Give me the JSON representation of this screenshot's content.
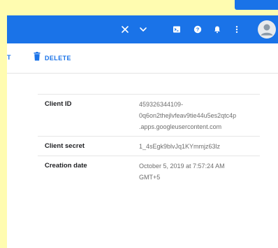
{
  "header": {
    "icons": [
      "close-icon",
      "chevron-down-icon",
      "cloud-shell-icon",
      "help-icon",
      "notifications-icon",
      "more-vert-icon",
      "account-avatar-icon"
    ]
  },
  "toolbar": {
    "partial_label": "T",
    "delete_label": "DELETE"
  },
  "details": {
    "rows": [
      {
        "label": "Client ID",
        "value_lines": [
          "459326344109-",
          "0q6on2thejlvfeav9tie44u5es2qtc4p",
          ".apps.googleusercontent.com"
        ]
      },
      {
        "label": "Client secret",
        "value_lines": [
          "1_4sEgk9blvJq1KYmmjz63lz"
        ]
      },
      {
        "label": "Creation date",
        "value_lines": [
          "October 5, 2019 at 7:57:24 AM",
          "GMT+5"
        ]
      }
    ]
  },
  "colors": {
    "header_bg": "#1a73e8",
    "page_margin": "#fffcb0",
    "accent": "#1a73e8"
  }
}
